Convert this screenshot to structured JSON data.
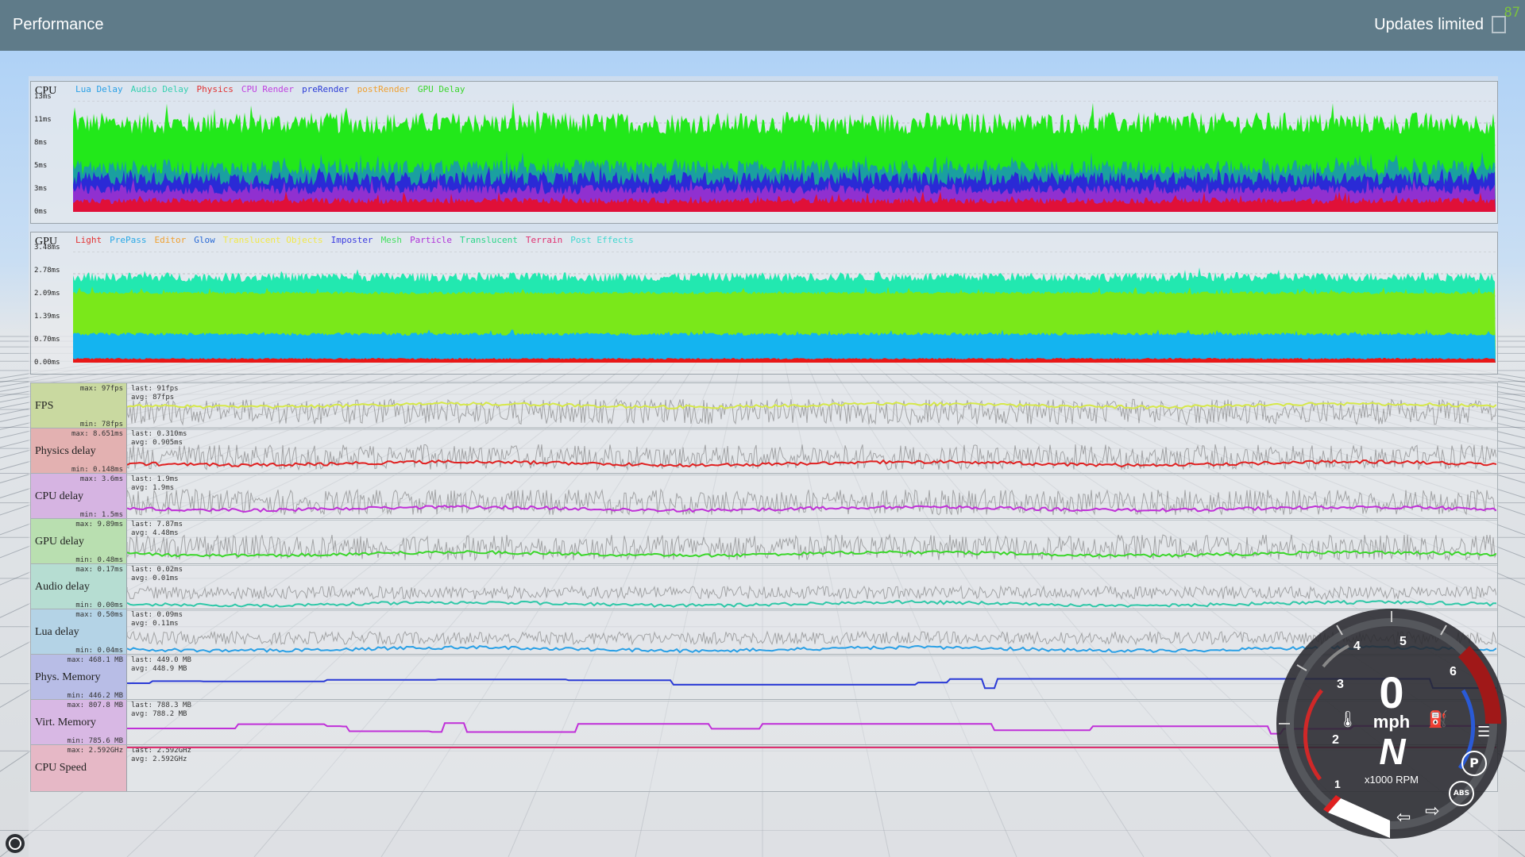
{
  "header": {
    "title": "Performance",
    "status": "Updates limited",
    "frame_counter": "87"
  },
  "cpu_graph": {
    "title": "CPU",
    "ticks": [
      "13ms",
      "11ms",
      "8ms",
      "5ms",
      "3ms",
      "0ms"
    ],
    "legend": [
      {
        "label": "Lua Delay",
        "color": "#2aa0e6"
      },
      {
        "label": "Audio Delay",
        "color": "#35d0b0"
      },
      {
        "label": "Physics",
        "color": "#e23232"
      },
      {
        "label": "CPU Render",
        "color": "#c040e0"
      },
      {
        "label": "preRender",
        "color": "#2a3ad6"
      },
      {
        "label": "postRender",
        "color": "#f0a030"
      },
      {
        "label": "GPU Delay",
        "color": "#3ad62a"
      }
    ]
  },
  "gpu_graph": {
    "title": "GPU",
    "ticks": [
      "3.48ms",
      "2.78ms",
      "2.09ms",
      "1.39ms",
      "0.70ms",
      "0.00ms"
    ],
    "legend": [
      {
        "label": "Light",
        "color": "#e23232"
      },
      {
        "label": "PrePass",
        "color": "#2aa8e6"
      },
      {
        "label": "Editor",
        "color": "#f0a030"
      },
      {
        "label": "Glow",
        "color": "#2a6ad6"
      },
      {
        "label": "Translucent Objects",
        "color": "#f2e84a"
      },
      {
        "label": "Imposter",
        "color": "#3a3ae0"
      },
      {
        "label": "Mesh",
        "color": "#44e060"
      },
      {
        "label": "Particle",
        "color": "#b030d8"
      },
      {
        "label": "Translucent",
        "color": "#2ad688"
      },
      {
        "label": "Terrain",
        "color": "#e03070"
      },
      {
        "label": "Post Effects",
        "color": "#40d8d0"
      }
    ]
  },
  "rows": [
    {
      "name": "FPS",
      "max": "max: 97fps",
      "min": "min: 78fps",
      "last": "last: 91fps",
      "avg": "avg: 87fps",
      "color": "#d6e84a",
      "label_bg": "#c9d9a0"
    },
    {
      "name": "Physics delay",
      "max": "max: 8.651ms",
      "min": "min: 0.148ms",
      "last": "last: 0.310ms",
      "avg": "avg: 0.905ms",
      "color": "#e02020",
      "label_bg": "#e3b1b1"
    },
    {
      "name": "CPU delay",
      "max": "max: 3.6ms",
      "min": "min: 1.5ms",
      "last": "last: 1.9ms",
      "avg": "avg: 1.9ms",
      "color": "#c030d8",
      "label_bg": "#d6b4e2"
    },
    {
      "name": "GPU delay",
      "max": "max: 9.89ms",
      "min": "min: 0.48ms",
      "last": "last: 7.87ms",
      "avg": "avg: 4.48ms",
      "color": "#3ad62a",
      "label_bg": "#b9dfb0"
    },
    {
      "name": "Audio delay",
      "max": "max: 0.17ms",
      "min": "min: 0.00ms",
      "last": "last: 0.02ms",
      "avg": "avg: 0.01ms",
      "color": "#30c8a8",
      "label_bg": "#b6ddd2"
    },
    {
      "name": "Lua delay",
      "max": "max: 0.50ms",
      "min": "min: 0.04ms",
      "last": "last: 0.09ms",
      "avg": "avg: 0.11ms",
      "color": "#2aa0e6",
      "label_bg": "#b4d3e6"
    },
    {
      "name": "Phys. Memory",
      "max": "max: 468.1 MB",
      "min": "min: 446.2 MB",
      "last": "last: 449.0 MB",
      "avg": "avg: 448.9 MB",
      "color": "#2a3ad6",
      "label_bg": "#b8bde6"
    },
    {
      "name": "Virt. Memory",
      "max": "max: 807.8 MB",
      "min": "min: 785.6 MB",
      "last": "last: 788.3 MB",
      "avg": "avg: 788.2 MB",
      "color": "#c030d8",
      "label_bg": "#d8b8e4"
    },
    {
      "name": "CPU Speed",
      "max": "max: 2.592GHz",
      "min": "",
      "last": "last: 2.592GHz",
      "avg": "avg: 2.592GHz",
      "color": "#e03070",
      "label_bg": "#e6b8c6"
    }
  ],
  "gauge": {
    "speed": "0",
    "unit": "mph",
    "gear": "N",
    "rpm_label": "x1000 RPM",
    "rpm_marks": [
      "1",
      "2",
      "3",
      "4",
      "5",
      "6"
    ],
    "abs_label": "ABS",
    "park_label": "P"
  }
}
